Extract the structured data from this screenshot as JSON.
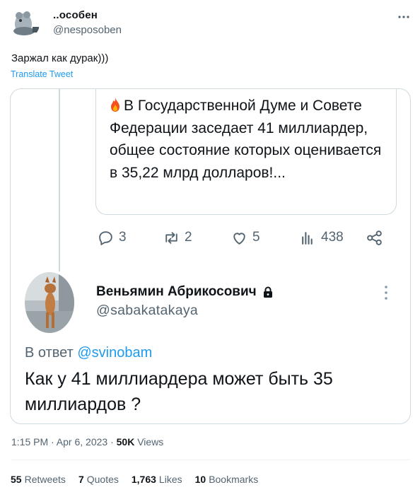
{
  "author": {
    "name": "..особен",
    "handle": "@nesposoben"
  },
  "tweet": {
    "text": "Заржал как дурак)))",
    "translate_label": "Translate Tweet"
  },
  "quoted_tweet": {
    "text": "В Государственной Думе и Совете Федерации заседает 41 миллиардер, общее состояние которых оценивается в 35,22 млрд долларов!...",
    "actions": {
      "replies": "3",
      "retweets": "2",
      "likes": "5",
      "views": "438"
    }
  },
  "reply": {
    "author_name": "Веньямин Абрикосович",
    "author_handle": "@sabakatakaya",
    "reply_prefix": "В ответ",
    "reply_mention": "@svinobam",
    "text": "Как у 41 миллиардера может быть 35 миллиардов ?"
  },
  "meta": {
    "time": "1:15 PM · Apr 6, 2023 · ",
    "views_count": "50K",
    "views_label": " Views"
  },
  "stats": {
    "retweets_count": "55",
    "retweets_label": "Retweets",
    "quotes_count": "7",
    "quotes_label": "Quotes",
    "likes_count": "1,763",
    "likes_label": "Likes",
    "bookmarks_count": "10",
    "bookmarks_label": "Bookmarks"
  },
  "colors": {
    "accent": "#1d9bf0",
    "muted": "#536471",
    "border": "#cfd9de"
  },
  "icons": [
    "reply-icon",
    "retweet-icon",
    "like-icon",
    "views-icon",
    "share-icon",
    "lock-icon",
    "more-icon",
    "fire-icon"
  ]
}
